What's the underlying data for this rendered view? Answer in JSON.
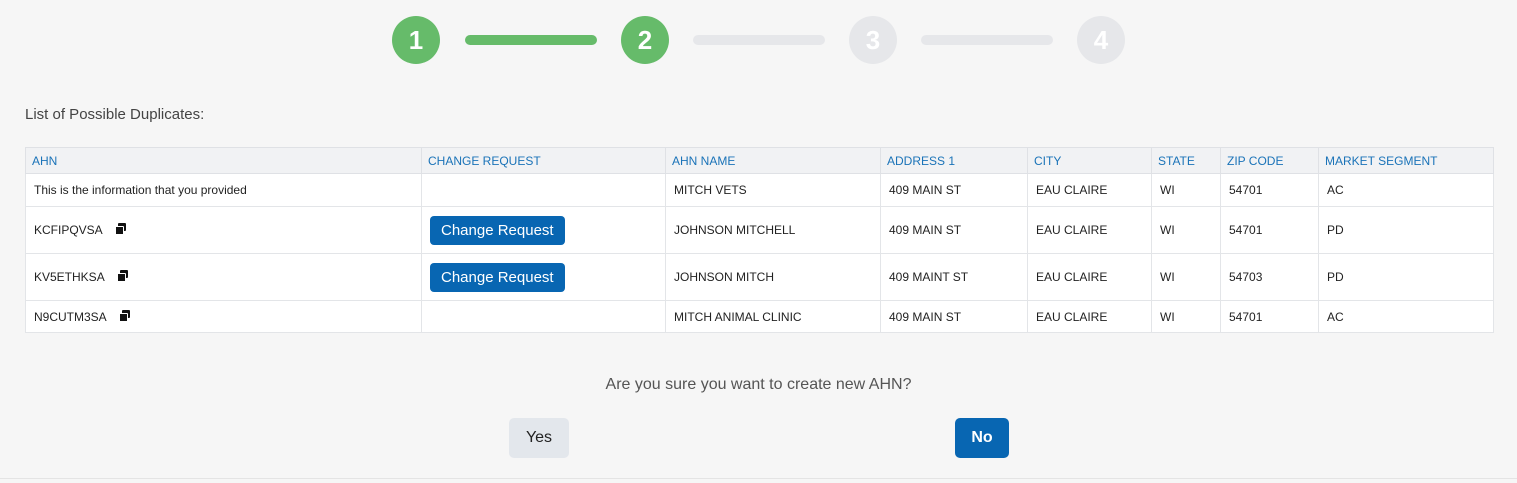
{
  "stepper": {
    "steps": [
      {
        "label": "1",
        "state": "done"
      },
      {
        "label": "2",
        "state": "done"
      },
      {
        "label": "3",
        "state": "todo"
      },
      {
        "label": "4",
        "state": "todo"
      }
    ],
    "colors": {
      "done": "#66bb6a",
      "todo": "#e6e7ea"
    }
  },
  "list_title": "List of Possible Duplicates:",
  "table": {
    "headers": [
      "AHN",
      "CHANGE REQUEST",
      "AHN NAME",
      "ADDRESS 1",
      "CITY",
      "STATE",
      "ZIP CODE",
      "MARKET SEGMENT"
    ],
    "rows": [
      {
        "ahn": "This is the information that you provided",
        "change_request": "",
        "ahn_name": "MITCH VETS",
        "address1": "409 MAIN ST",
        "city": "EAU CLAIRE",
        "state": "WI",
        "zip": "54701",
        "segment": "AC"
      },
      {
        "ahn": "KCFIPQVSA",
        "change_request": "Change Request",
        "ahn_name": "JOHNSON MITCHELL",
        "address1": "409 MAIN ST",
        "city": "EAU CLAIRE",
        "state": "WI",
        "zip": "54701",
        "segment": "PD"
      },
      {
        "ahn": "KV5ETHKSA",
        "change_request": "Change Request",
        "ahn_name": "JOHNSON MITCH",
        "address1": "409 MAINT ST",
        "city": "EAU CLAIRE",
        "state": "WI",
        "zip": "54703",
        "segment": "PD"
      },
      {
        "ahn": "N9CUTM3SA",
        "change_request": "",
        "ahn_name": "MITCH ANIMAL CLINIC",
        "address1": "409 MAIN ST",
        "city": "EAU CLAIRE",
        "state": "WI",
        "zip": "54701",
        "segment": "AC"
      }
    ]
  },
  "icons": {
    "copy": "copy-icon"
  },
  "confirm": {
    "question": "Are you sure you want to create new AHN?",
    "yes_label": "Yes",
    "no_label": "No"
  },
  "colors": {
    "accent": "#0866b2",
    "header_text": "#1a73b8"
  }
}
